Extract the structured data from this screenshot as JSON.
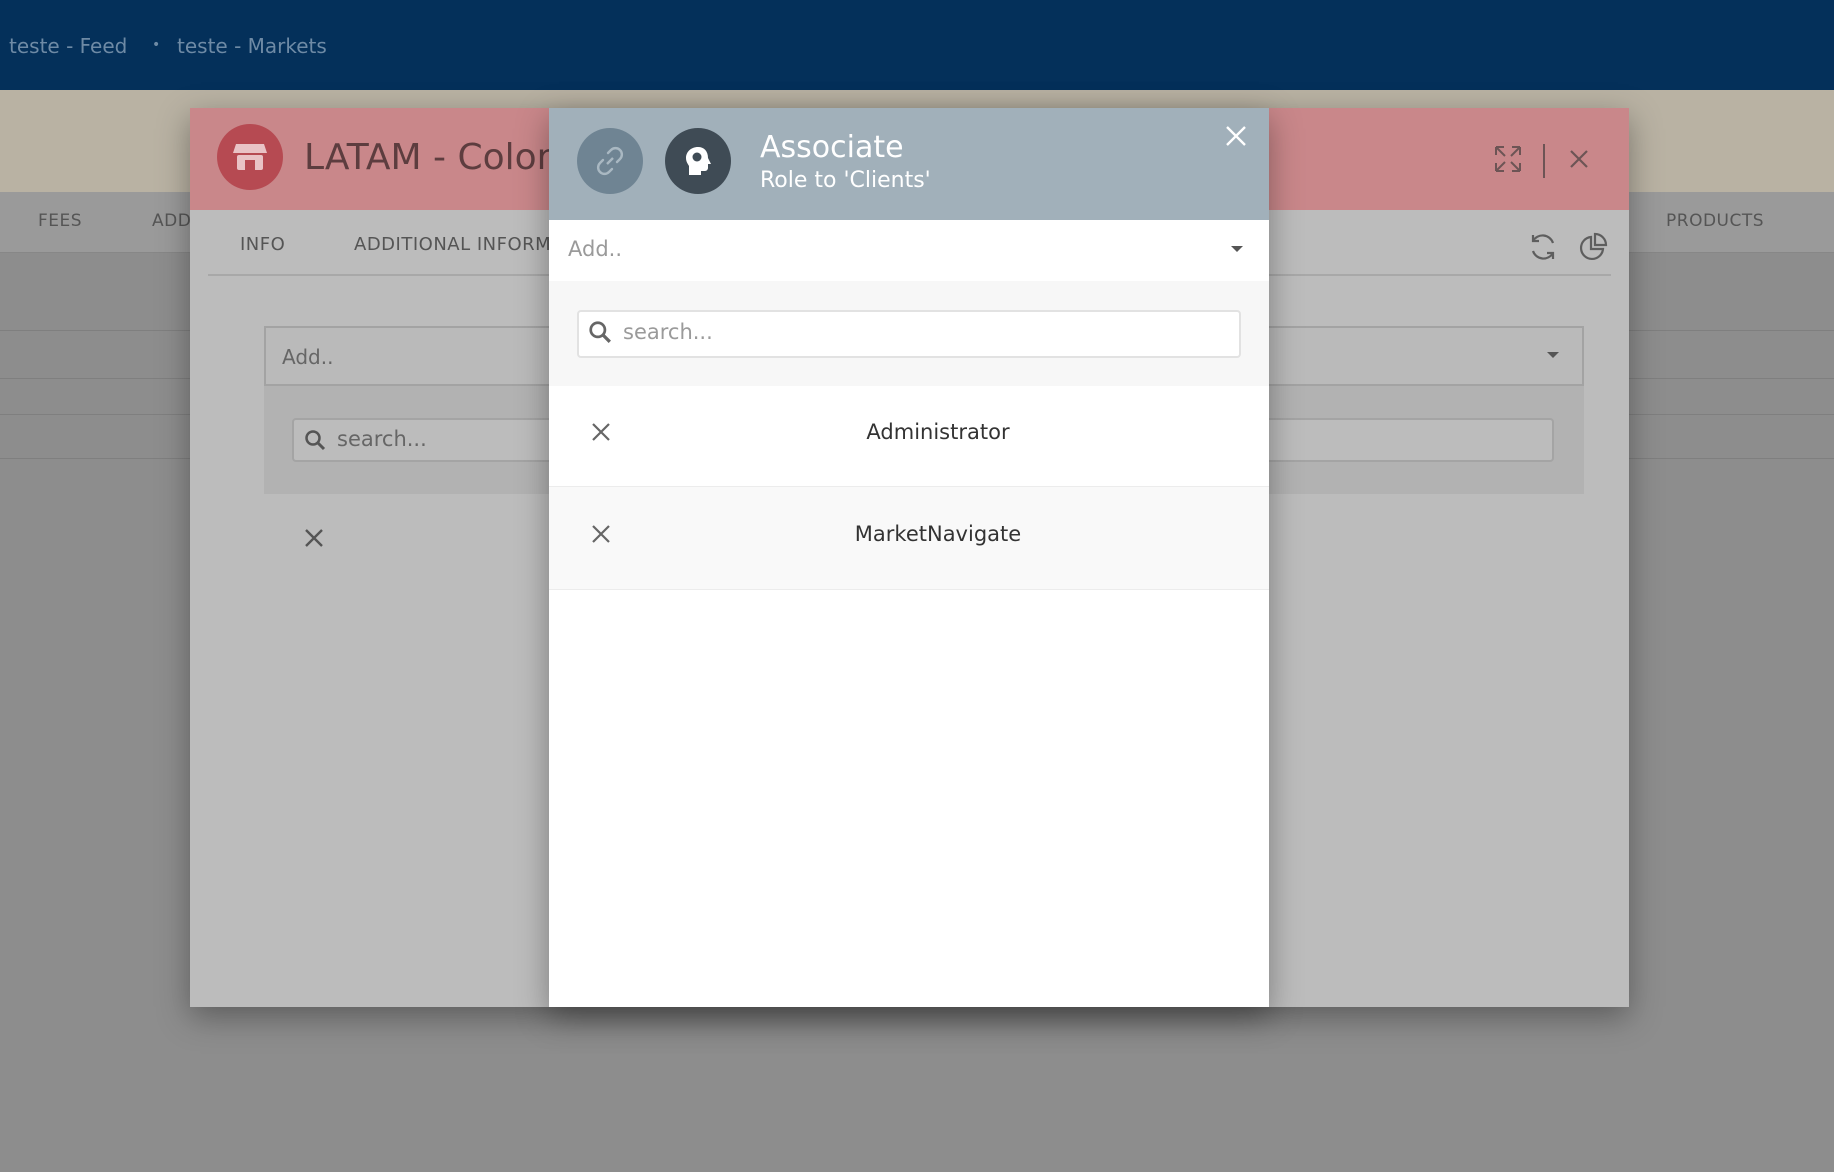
{
  "topbar": {
    "crumbs": [
      "teste - Feed",
      "teste - Markets"
    ],
    "separator": "•"
  },
  "background_tabs": [
    "FEES",
    "ADD",
    "PRODUCTS"
  ],
  "back_modal": {
    "title": "LATAM - Colomb",
    "tabs": [
      "INFO",
      "ADDITIONAL INFORM"
    ],
    "select_placeholder": "Add..",
    "search_placeholder": "search..."
  },
  "associate_modal": {
    "title": "Associate",
    "subtitle": "Role to 'Clients'",
    "select_placeholder": "Add..",
    "search_placeholder": "search...",
    "items": [
      {
        "label": "Administrator"
      },
      {
        "label": "MarketNavigate"
      }
    ]
  },
  "colors": {
    "topbar": "#04305a",
    "back_header": "#c9878a",
    "front_header": "#a1b0ba",
    "accent_red": "#b64a52"
  }
}
